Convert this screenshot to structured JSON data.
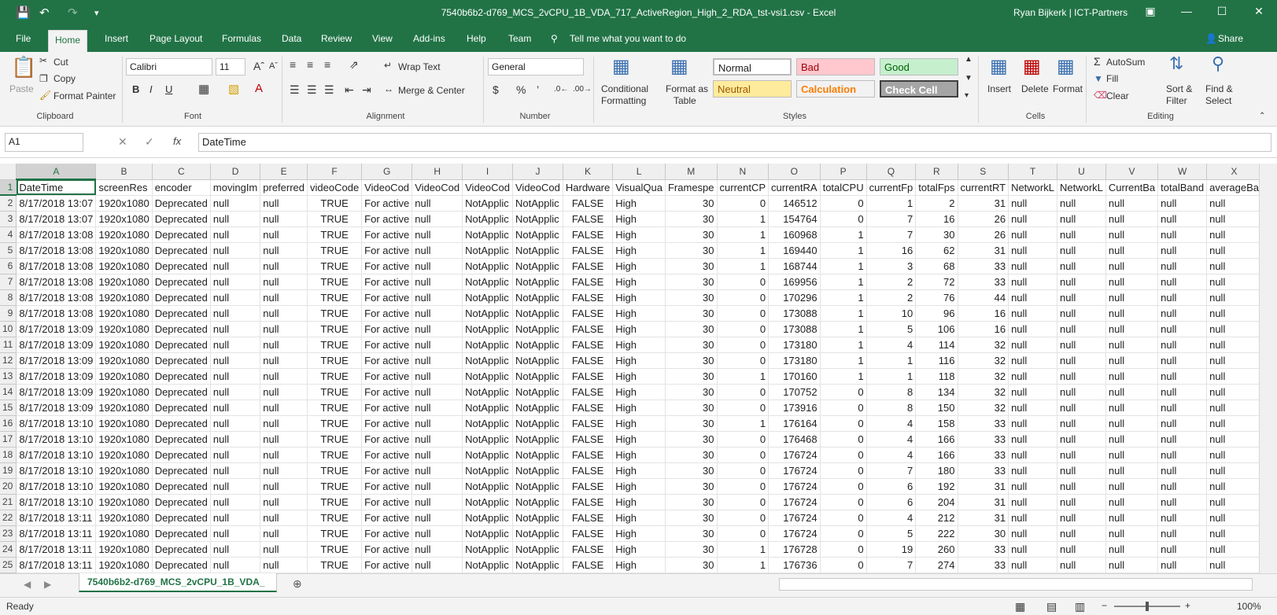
{
  "colors": {
    "accent": "#217346",
    "bad_bg": "#ffc7ce",
    "good_bg": "#c6efce",
    "neutral_bg": "#ffeb9c",
    "check_bg": "#a5a5a5"
  },
  "window": {
    "title": "7540b6b2-d769_MCS_2vCPU_1B_VDA_717_ActiveRegion_High_2_RDA_tst-vsi1.csv  -  Excel",
    "user": "Ryan Bijkerk | ICT-Partners"
  },
  "tabs": [
    "File",
    "Home",
    "Insert",
    "Page Layout",
    "Formulas",
    "Data",
    "Review",
    "View",
    "Add-ins",
    "Help",
    "Team"
  ],
  "tell_me": "Tell me what you want to do",
  "share": "Share",
  "ribbon": {
    "clipboard": {
      "paste": "Paste",
      "cut": "Cut",
      "copy": "Copy",
      "format_painter": "Format Painter",
      "label": "Clipboard"
    },
    "font": {
      "name": "Calibri",
      "size": "11",
      "label": "Font"
    },
    "alignment": {
      "wrap": "Wrap Text",
      "merge": "Merge & Center",
      "label": "Alignment"
    },
    "number": {
      "format": "General",
      "label": "Number"
    },
    "styles": {
      "conditional": "Conditional",
      "formatting": "Formatting",
      "format_as": "Format as",
      "table": "Table",
      "normal": "Normal",
      "bad": "Bad",
      "good": "Good",
      "neutral": "Neutral",
      "calculation": "Calculation",
      "check_cell": "Check Cell",
      "label": "Styles"
    },
    "cells": {
      "insert": "Insert",
      "delete": "Delete",
      "format": "Format",
      "label": "Cells"
    },
    "editing": {
      "autosum": "AutoSum",
      "fill": "Fill",
      "clear": "Clear",
      "sort": "Sort &",
      "filter": "Filter",
      "find": "Find &",
      "select": "Select",
      "label": "Editing"
    }
  },
  "formula_bar": {
    "name_box": "A1",
    "content": "DateTime"
  },
  "columns": [
    "A",
    "B",
    "C",
    "D",
    "E",
    "F",
    "G",
    "H",
    "I",
    "J",
    "K",
    "L",
    "M",
    "N",
    "O",
    "P",
    "Q",
    "R",
    "S",
    "T",
    "U",
    "V",
    "W",
    "X"
  ],
  "headers": [
    "DateTime",
    "screenRes",
    "encoder",
    "movingIm",
    "preferred",
    "videoCode",
    "VideoCod",
    "VideoCod",
    "VideoCod",
    "VideoCod",
    "Hardware",
    "VisualQua",
    "Framespe",
    "currentCP",
    "currentRA",
    "totalCPU",
    "currentFp",
    "totalFps",
    "currentRT",
    "NetworkL",
    "NetworkL",
    "CurrentBa",
    "totalBand",
    "averageBa"
  ],
  "rows": [
    [
      "8/17/2018 13:07",
      "1920x1080",
      "Deprecated",
      "null",
      "null",
      "TRUE",
      "For active",
      "null",
      "NotApplic",
      "NotApplic",
      "FALSE",
      "High",
      "30",
      "0",
      "146512",
      "0",
      "1",
      "2",
      "31",
      "null",
      "null",
      "null",
      "null",
      "null"
    ],
    [
      "8/17/2018 13:07",
      "1920x1080",
      "Deprecated",
      "null",
      "null",
      "TRUE",
      "For active",
      "null",
      "NotApplic",
      "NotApplic",
      "FALSE",
      "High",
      "30",
      "1",
      "154764",
      "0",
      "7",
      "16",
      "26",
      "null",
      "null",
      "null",
      "null",
      "null"
    ],
    [
      "8/17/2018 13:08",
      "1920x1080",
      "Deprecated",
      "null",
      "null",
      "TRUE",
      "For active",
      "null",
      "NotApplic",
      "NotApplic",
      "FALSE",
      "High",
      "30",
      "1",
      "160968",
      "1",
      "7",
      "30",
      "26",
      "null",
      "null",
      "null",
      "null",
      "null"
    ],
    [
      "8/17/2018 13:08",
      "1920x1080",
      "Deprecated",
      "null",
      "null",
      "TRUE",
      "For active",
      "null",
      "NotApplic",
      "NotApplic",
      "FALSE",
      "High",
      "30",
      "1",
      "169440",
      "1",
      "16",
      "62",
      "31",
      "null",
      "null",
      "null",
      "null",
      "null"
    ],
    [
      "8/17/2018 13:08",
      "1920x1080",
      "Deprecated",
      "null",
      "null",
      "TRUE",
      "For active",
      "null",
      "NotApplic",
      "NotApplic",
      "FALSE",
      "High",
      "30",
      "1",
      "168744",
      "1",
      "3",
      "68",
      "33",
      "null",
      "null",
      "null",
      "null",
      "null"
    ],
    [
      "8/17/2018 13:08",
      "1920x1080",
      "Deprecated",
      "null",
      "null",
      "TRUE",
      "For active",
      "null",
      "NotApplic",
      "NotApplic",
      "FALSE",
      "High",
      "30",
      "0",
      "169956",
      "1",
      "2",
      "72",
      "33",
      "null",
      "null",
      "null",
      "null",
      "null"
    ],
    [
      "8/17/2018 13:08",
      "1920x1080",
      "Deprecated",
      "null",
      "null",
      "TRUE",
      "For active",
      "null",
      "NotApplic",
      "NotApplic",
      "FALSE",
      "High",
      "30",
      "0",
      "170296",
      "1",
      "2",
      "76",
      "44",
      "null",
      "null",
      "null",
      "null",
      "null"
    ],
    [
      "8/17/2018 13:08",
      "1920x1080",
      "Deprecated",
      "null",
      "null",
      "TRUE",
      "For active",
      "null",
      "NotApplic",
      "NotApplic",
      "FALSE",
      "High",
      "30",
      "0",
      "173088",
      "1",
      "10",
      "96",
      "16",
      "null",
      "null",
      "null",
      "null",
      "null"
    ],
    [
      "8/17/2018 13:09",
      "1920x1080",
      "Deprecated",
      "null",
      "null",
      "TRUE",
      "For active",
      "null",
      "NotApplic",
      "NotApplic",
      "FALSE",
      "High",
      "30",
      "0",
      "173088",
      "1",
      "5",
      "106",
      "16",
      "null",
      "null",
      "null",
      "null",
      "null"
    ],
    [
      "8/17/2018 13:09",
      "1920x1080",
      "Deprecated",
      "null",
      "null",
      "TRUE",
      "For active",
      "null",
      "NotApplic",
      "NotApplic",
      "FALSE",
      "High",
      "30",
      "0",
      "173180",
      "1",
      "4",
      "114",
      "32",
      "null",
      "null",
      "null",
      "null",
      "null"
    ],
    [
      "8/17/2018 13:09",
      "1920x1080",
      "Deprecated",
      "null",
      "null",
      "TRUE",
      "For active",
      "null",
      "NotApplic",
      "NotApplic",
      "FALSE",
      "High",
      "30",
      "0",
      "173180",
      "1",
      "1",
      "116",
      "32",
      "null",
      "null",
      "null",
      "null",
      "null"
    ],
    [
      "8/17/2018 13:09",
      "1920x1080",
      "Deprecated",
      "null",
      "null",
      "TRUE",
      "For active",
      "null",
      "NotApplic",
      "NotApplic",
      "FALSE",
      "High",
      "30",
      "1",
      "170160",
      "1",
      "1",
      "118",
      "32",
      "null",
      "null",
      "null",
      "null",
      "null"
    ],
    [
      "8/17/2018 13:09",
      "1920x1080",
      "Deprecated",
      "null",
      "null",
      "TRUE",
      "For active",
      "null",
      "NotApplic",
      "NotApplic",
      "FALSE",
      "High",
      "30",
      "0",
      "170752",
      "0",
      "8",
      "134",
      "32",
      "null",
      "null",
      "null",
      "null",
      "null"
    ],
    [
      "8/17/2018 13:09",
      "1920x1080",
      "Deprecated",
      "null",
      "null",
      "TRUE",
      "For active",
      "null",
      "NotApplic",
      "NotApplic",
      "FALSE",
      "High",
      "30",
      "0",
      "173916",
      "0",
      "8",
      "150",
      "32",
      "null",
      "null",
      "null",
      "null",
      "null"
    ],
    [
      "8/17/2018 13:10",
      "1920x1080",
      "Deprecated",
      "null",
      "null",
      "TRUE",
      "For active",
      "null",
      "NotApplic",
      "NotApplic",
      "FALSE",
      "High",
      "30",
      "1",
      "176164",
      "0",
      "4",
      "158",
      "33",
      "null",
      "null",
      "null",
      "null",
      "null"
    ],
    [
      "8/17/2018 13:10",
      "1920x1080",
      "Deprecated",
      "null",
      "null",
      "TRUE",
      "For active",
      "null",
      "NotApplic",
      "NotApplic",
      "FALSE",
      "High",
      "30",
      "0",
      "176468",
      "0",
      "4",
      "166",
      "33",
      "null",
      "null",
      "null",
      "null",
      "null"
    ],
    [
      "8/17/2018 13:10",
      "1920x1080",
      "Deprecated",
      "null",
      "null",
      "TRUE",
      "For active",
      "null",
      "NotApplic",
      "NotApplic",
      "FALSE",
      "High",
      "30",
      "0",
      "176724",
      "0",
      "4",
      "166",
      "33",
      "null",
      "null",
      "null",
      "null",
      "null"
    ],
    [
      "8/17/2018 13:10",
      "1920x1080",
      "Deprecated",
      "null",
      "null",
      "TRUE",
      "For active",
      "null",
      "NotApplic",
      "NotApplic",
      "FALSE",
      "High",
      "30",
      "0",
      "176724",
      "0",
      "7",
      "180",
      "33",
      "null",
      "null",
      "null",
      "null",
      "null"
    ],
    [
      "8/17/2018 13:10",
      "1920x1080",
      "Deprecated",
      "null",
      "null",
      "TRUE",
      "For active",
      "null",
      "NotApplic",
      "NotApplic",
      "FALSE",
      "High",
      "30",
      "0",
      "176724",
      "0",
      "6",
      "192",
      "31",
      "null",
      "null",
      "null",
      "null",
      "null"
    ],
    [
      "8/17/2018 13:10",
      "1920x1080",
      "Deprecated",
      "null",
      "null",
      "TRUE",
      "For active",
      "null",
      "NotApplic",
      "NotApplic",
      "FALSE",
      "High",
      "30",
      "0",
      "176724",
      "0",
      "6",
      "204",
      "31",
      "null",
      "null",
      "null",
      "null",
      "null"
    ],
    [
      "8/17/2018 13:11",
      "1920x1080",
      "Deprecated",
      "null",
      "null",
      "TRUE",
      "For active",
      "null",
      "NotApplic",
      "NotApplic",
      "FALSE",
      "High",
      "30",
      "0",
      "176724",
      "0",
      "4",
      "212",
      "31",
      "null",
      "null",
      "null",
      "null",
      "null"
    ],
    [
      "8/17/2018 13:11",
      "1920x1080",
      "Deprecated",
      "null",
      "null",
      "TRUE",
      "For active",
      "null",
      "NotApplic",
      "NotApplic",
      "FALSE",
      "High",
      "30",
      "0",
      "176724",
      "0",
      "5",
      "222",
      "30",
      "null",
      "null",
      "null",
      "null",
      "null"
    ],
    [
      "8/17/2018 13:11",
      "1920x1080",
      "Deprecated",
      "null",
      "null",
      "TRUE",
      "For active",
      "null",
      "NotApplic",
      "NotApplic",
      "FALSE",
      "High",
      "30",
      "1",
      "176728",
      "0",
      "19",
      "260",
      "33",
      "null",
      "null",
      "null",
      "null",
      "null"
    ],
    [
      "8/17/2018 13:11",
      "1920x1080",
      "Deprecated",
      "null",
      "null",
      "TRUE",
      "For active",
      "null",
      "NotApplic",
      "NotApplic",
      "FALSE",
      "High",
      "30",
      "1",
      "176736",
      "0",
      "7",
      "274",
      "33",
      "null",
      "null",
      "null",
      "null",
      "null"
    ]
  ],
  "sheet_tab": "7540b6b2-d769_MCS_2vCPU_1B_VDA_",
  "status": {
    "ready": "Ready",
    "zoom": "100%"
  }
}
